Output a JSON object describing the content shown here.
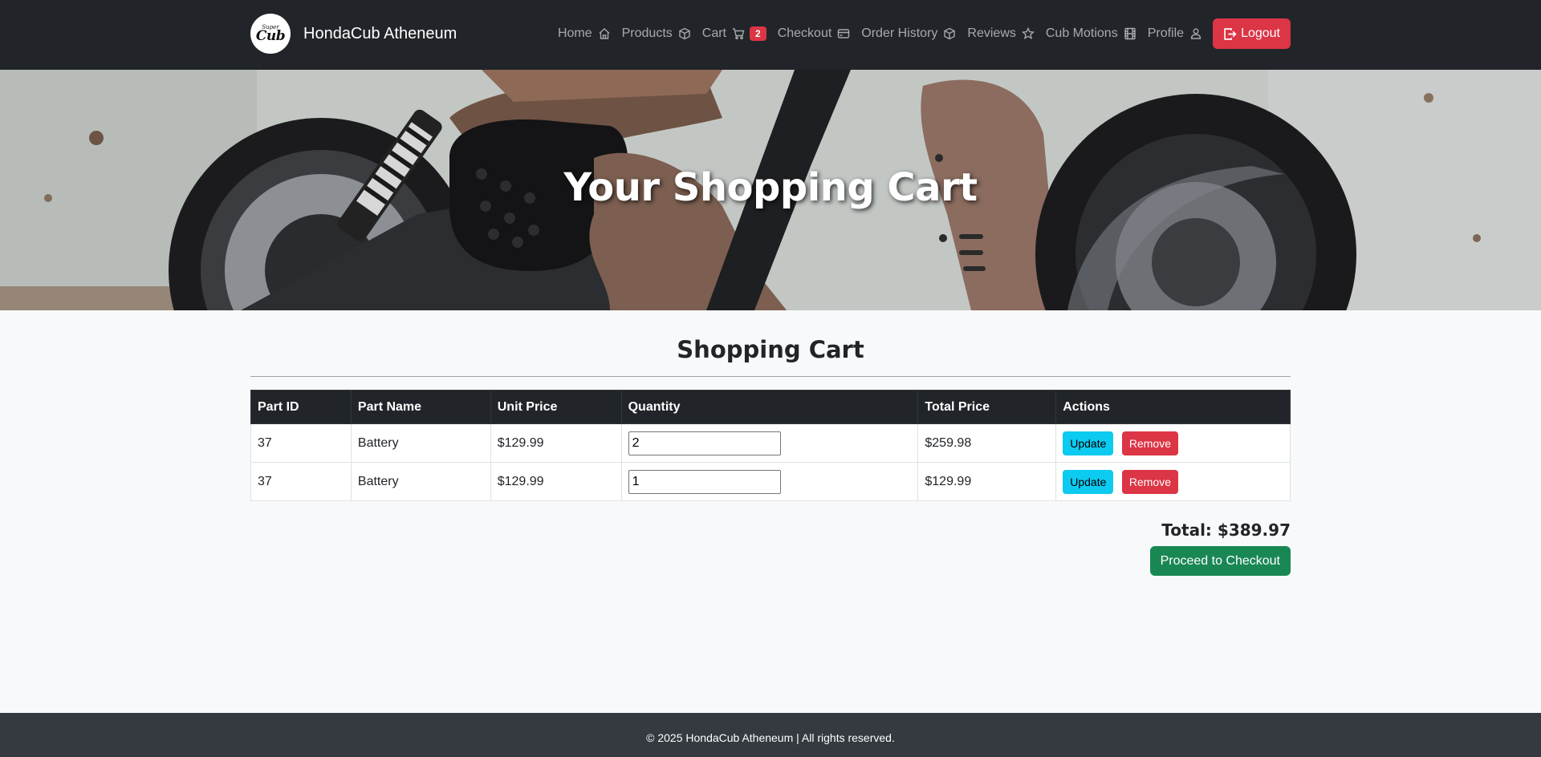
{
  "brand": {
    "logo_small": "Super",
    "logo_big": "Cub",
    "name": "HondaCub Atheneum"
  },
  "nav": {
    "items": [
      {
        "label": "Home",
        "icon": "house-icon"
      },
      {
        "label": "Products",
        "icon": "box-icon"
      },
      {
        "label": "Cart",
        "icon": "cart-icon",
        "badge": "2"
      },
      {
        "label": "Checkout",
        "icon": "credit-card-icon"
      },
      {
        "label": "Order History",
        "icon": "box-icon"
      },
      {
        "label": "Reviews",
        "icon": "star-icon"
      },
      {
        "label": "Cub Motions",
        "icon": "film-icon"
      },
      {
        "label": "Profile",
        "icon": "person-icon"
      }
    ],
    "logout_label": "Logout"
  },
  "hero": {
    "title": "Your Shopping Cart"
  },
  "cart": {
    "title": "Shopping Cart",
    "headers": [
      "Part ID",
      "Part Name",
      "Unit Price",
      "Quantity",
      "Total Price",
      "Actions"
    ],
    "rows": [
      {
        "part_id": "37",
        "part_name": "Battery",
        "unit_price": "$129.99",
        "quantity": "2",
        "total_price": "$259.98",
        "update_label": "Update",
        "remove_label": "Remove"
      },
      {
        "part_id": "37",
        "part_name": "Battery",
        "unit_price": "$129.99",
        "quantity": "1",
        "total_price": "$129.99",
        "update_label": "Update",
        "remove_label": "Remove"
      }
    ],
    "total": "Total: $389.97",
    "checkout_label": "Proceed to Checkout"
  },
  "footer": {
    "text": "© 2025 HondaCub Atheneum | All rights reserved."
  },
  "colors": {
    "navbar": "#212529",
    "danger": "#dc3545",
    "info": "#0dcaf0",
    "success": "#198754",
    "footer": "#343a40"
  }
}
